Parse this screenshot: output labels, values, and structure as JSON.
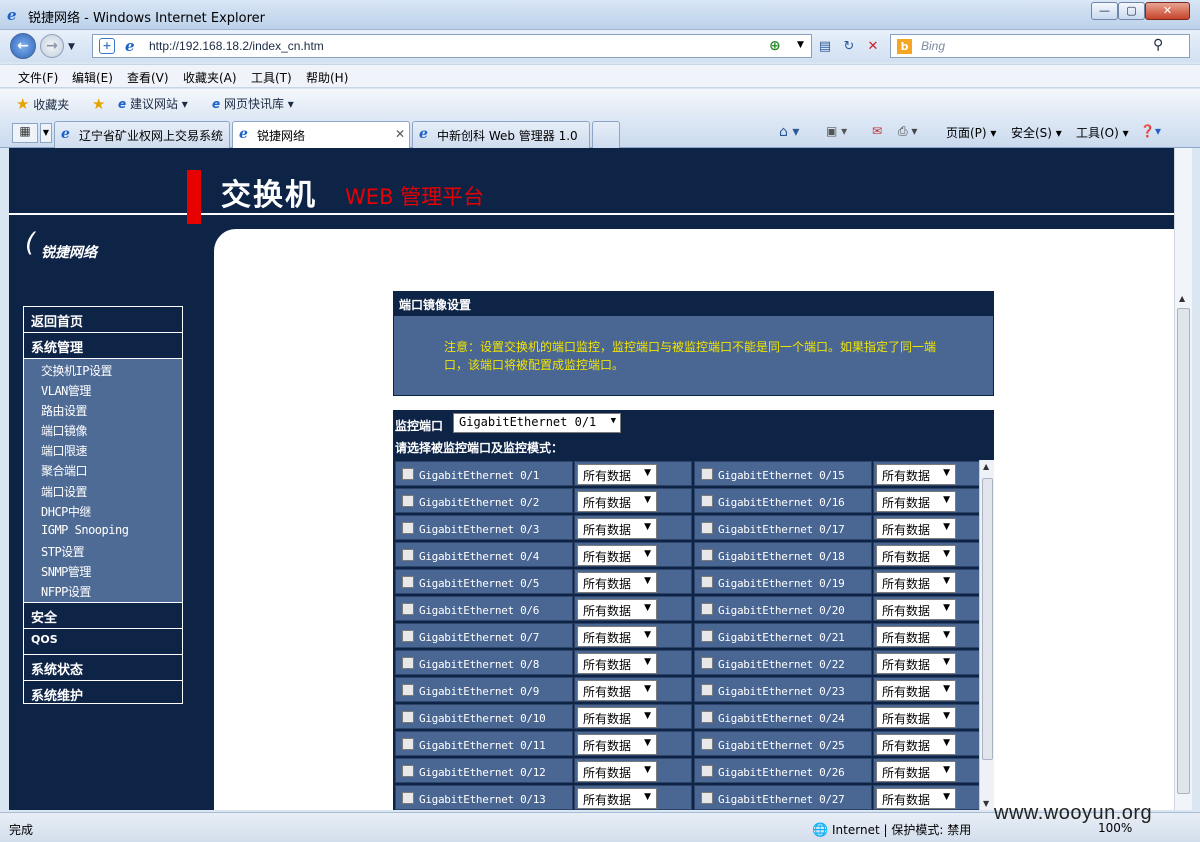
{
  "window": {
    "title": "锐捷网络 - Windows Internet Explorer",
    "minimize": "—",
    "maximize": "▢",
    "close": "✕"
  },
  "nav": {
    "url": "http://192.168.18.2/index_cn.htm",
    "search_placeholder": "Bing"
  },
  "menu": [
    "文件(F)",
    "编辑(E)",
    "查看(V)",
    "收藏夹(A)",
    "工具(T)",
    "帮助(H)"
  ],
  "favorites": {
    "label": "收藏夹",
    "items": [
      "建议网站 ▾",
      "网页快讯库 ▾"
    ]
  },
  "tabs": [
    {
      "label": "辽宁省矿业权网上交易系统"
    },
    {
      "label": "锐捷网络"
    },
    {
      "label": "中新创科 Web 管理器 1.0"
    }
  ],
  "commands": {
    "page": "页面(P) ▾",
    "safety": "安全(S) ▾",
    "tools": "工具(O) ▾"
  },
  "header": {
    "title": "交换机",
    "subtitle": "WEB 管理平台",
    "logo_text": "锐捷网络"
  },
  "sidebar": {
    "home": "返回首页",
    "switch_mgmt": "系统管理",
    "sub_items": [
      "交换机IP设置",
      "VLAN管理",
      "路由设置",
      "端口镜像",
      "端口限速",
      "聚合端口",
      "端口设置",
      "DHCP中继",
      "IGMP Snooping",
      "STP设置",
      "SNMP管理",
      "NFPP设置"
    ],
    "bottom_items": [
      "安全",
      "QOS",
      "系统状态",
      "系统维护"
    ]
  },
  "mirror": {
    "title": "端口镜像设置",
    "notice": "注意：设置交换机的端口监控，监控端口与被监控端口不能是同一个端口。如果指定了同一端口，该端口将被配置成监控端口。",
    "monitor_label": "监控端口",
    "monitor_value": "GigabitEthernet 0/1",
    "instruction": "请选择被监控端口及监控模式：",
    "mode_default": "所有数据",
    "ports_left": [
      "GigabitEthernet 0/1",
      "GigabitEthernet 0/2",
      "GigabitEthernet 0/3",
      "GigabitEthernet 0/4",
      "GigabitEthernet 0/5",
      "GigabitEthernet 0/6",
      "GigabitEthernet 0/7",
      "GigabitEthernet 0/8",
      "GigabitEthernet 0/9",
      "GigabitEthernet 0/10",
      "GigabitEthernet 0/11",
      "GigabitEthernet 0/12",
      "GigabitEthernet 0/13"
    ],
    "ports_right": [
      "GigabitEthernet 0/15",
      "GigabitEthernet 0/16",
      "GigabitEthernet 0/17",
      "GigabitEthernet 0/18",
      "GigabitEthernet 0/19",
      "GigabitEthernet 0/20",
      "GigabitEthernet 0/21",
      "GigabitEthernet 0/22",
      "GigabitEthernet 0/23",
      "GigabitEthernet 0/24",
      "GigabitEthernet 0/25",
      "GigabitEthernet 0/26",
      "GigabitEthernet 0/27"
    ]
  },
  "status": {
    "text": "完成",
    "zone": "Internet | 保护模式: 禁用",
    "zoom": "100%"
  },
  "watermark": "www.wooyun.org"
}
